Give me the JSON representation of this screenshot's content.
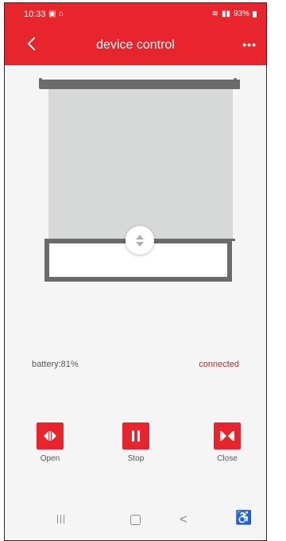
{
  "status_bar": {
    "time": "10:33",
    "notif_icons": "image-icon, home-icon",
    "right_icons": "wifi-icon, signal-icon",
    "battery": "93%"
  },
  "app_bar": {
    "title": "device control",
    "back_icon": "chevron-left-icon",
    "more_icon": "more-horizontal-icon",
    "more_label": "•••"
  },
  "device": {
    "battery_text": "battery:81%",
    "connection_text": "connected"
  },
  "controls": {
    "open_label": "Open",
    "stop_label": "Stop",
    "close_label": "Close"
  },
  "nav": {
    "back_glyph": "<",
    "accessibility_glyph": "♿"
  },
  "colors": {
    "accent": "#e8242c",
    "connection": "#c0262d",
    "shade": "#d7d9d8",
    "rod": "#6b6b6b"
  }
}
